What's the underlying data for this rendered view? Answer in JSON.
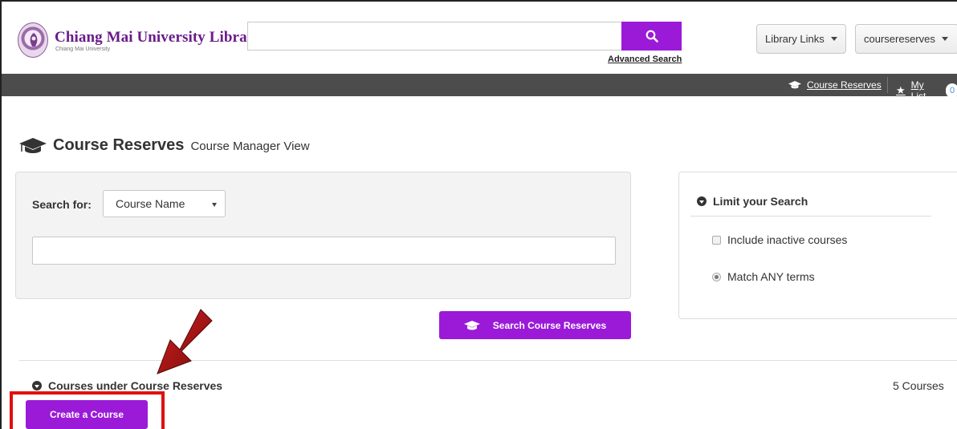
{
  "header": {
    "library_name": "Chiang Mai University Library",
    "library_subname": "Chiang Mai University",
    "search_value": "",
    "advanced_search_label": "Advanced Search",
    "library_links_label": "Library Links",
    "user_label": "coursereserves"
  },
  "navbar": {
    "course_reserves_label": "Course Reserves",
    "my_list_label": "My List",
    "my_list_count": "0"
  },
  "page": {
    "title": "Course Reserves",
    "subtitle": "Course Manager View"
  },
  "search": {
    "search_for_label": "Search for:",
    "field_selected": "Course Name",
    "query_value": "",
    "submit_label": "Search Course Reserves"
  },
  "limit": {
    "title": "Limit your Search",
    "include_inactive_label": "Include inactive courses",
    "match_any_label": "Match ANY terms"
  },
  "courses": {
    "heading": "Courses under Course Reserves",
    "count_label": "5 Courses",
    "create_label": "Create a Course"
  },
  "colors": {
    "accent_purple": "#9b1ad8",
    "brand_purple": "#6a1b8a",
    "navbar_bg": "#4c4c4c",
    "highlight_red": "#e01010"
  }
}
